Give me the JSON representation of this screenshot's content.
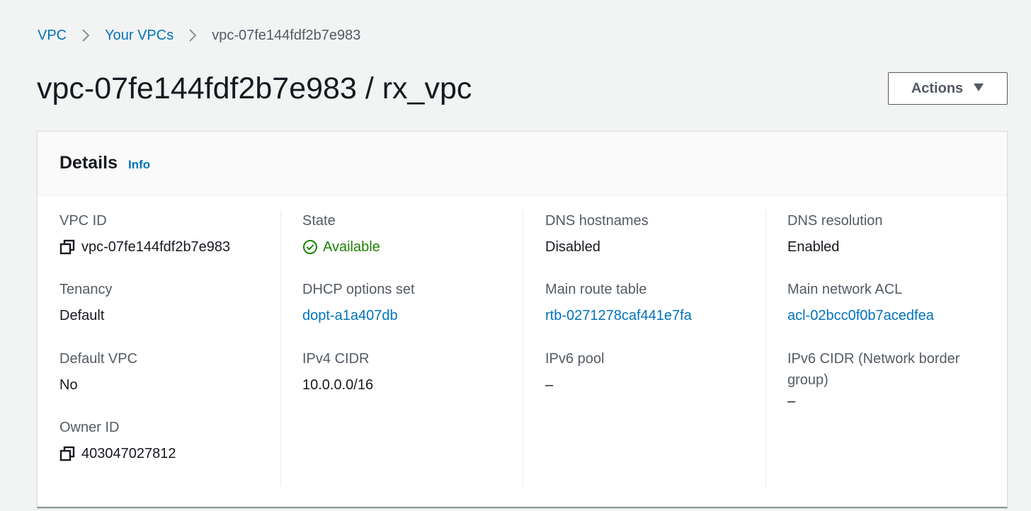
{
  "breadcrumb": {
    "items": [
      {
        "label": "VPC"
      },
      {
        "label": "Your VPCs"
      },
      {
        "label": "vpc-07fe144fdf2b7e983"
      }
    ]
  },
  "page": {
    "title": "vpc-07fe144fdf2b7e983 / rx_vpc",
    "actions_label": "Actions"
  },
  "details": {
    "title": "Details",
    "info_label": "Info",
    "columns": [
      {
        "fields": [
          {
            "label": "VPC ID",
            "value": "vpc-07fe144fdf2b7e983"
          },
          {
            "label": "Tenancy",
            "value": "Default"
          },
          {
            "label": "Default VPC",
            "value": "No"
          },
          {
            "label": "Owner ID",
            "value": "403047027812"
          }
        ]
      },
      {
        "fields": [
          {
            "label": "State",
            "value": "Available"
          },
          {
            "label": "DHCP options set",
            "value": "dopt-a1a407db"
          },
          {
            "label": "IPv4 CIDR",
            "value": "10.0.0.0/16"
          }
        ]
      },
      {
        "fields": [
          {
            "label": "DNS hostnames",
            "value": "Disabled"
          },
          {
            "label": "Main route table",
            "value": "rtb-0271278caf441e7fa"
          },
          {
            "label": "IPv6 pool",
            "value": "–"
          }
        ]
      },
      {
        "fields": [
          {
            "label": "DNS resolution",
            "value": "Enabled"
          },
          {
            "label": "Main network ACL",
            "value": "acl-02bcc0f0b7acedfea"
          },
          {
            "label": "IPv6 CIDR (Network border group)",
            "value": "–"
          }
        ]
      }
    ]
  },
  "icons": {
    "copy": "copy-icon",
    "status_ok": "status-success-icon",
    "separator": "chevron-right-icon",
    "caret": "caret-down-icon"
  },
  "colors": {
    "link": "#0073bb",
    "success": "#1d8102",
    "background": "#f2f3f3"
  }
}
